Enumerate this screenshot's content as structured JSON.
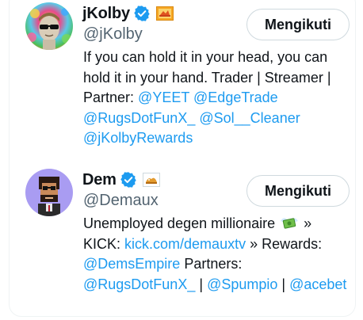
{
  "users": [
    {
      "display_name": "jKolby",
      "handle": "@jKolby",
      "follow_label": "Mengikuti",
      "bio": {
        "line1": "If you can hold it in your head, you can",
        "line2": "hold it in your hand. Trader | Streamer |",
        "line3_prefix": "Partner:",
        "mention_yeet": "@YEET",
        "mention_edgetrade": "@EdgeTrade",
        "mention_rugsdotfunx": "@RugsDotFunX_",
        "mention_sol_cleaner": "@Sol__Cleaner",
        "mention_rewards": "@jKolbyRewards"
      }
    },
    {
      "display_name": "Dem",
      "handle": "@Demaux",
      "follow_label": "Mengikuti",
      "bio": {
        "line1": "Unemployed degen millionaire",
        "line1_suffix": "»",
        "kick_prefix": "KICK:",
        "kick_link": "kick.com/demauxtv",
        "kick_suffix": "» Rewards:",
        "mention_demsempire": "@DemsEmpire",
        "partners_label": "Partners:",
        "mention_rugsdotfunx": "@RugsDotFunX_",
        "sep1": "|",
        "mention_spumpio": "@Spumpio",
        "sep2": "|",
        "mention_acebet": "@acebet"
      }
    }
  ],
  "colors": {
    "link": "#1d9bf0",
    "verified": "#1d9bf0",
    "secondary_text": "#536471",
    "border": "#cfd9de"
  },
  "icons": {
    "verified": "verified-badge-icon",
    "affiliate": "affiliate-badge-icon",
    "money": "money-with-wings-emoji"
  }
}
